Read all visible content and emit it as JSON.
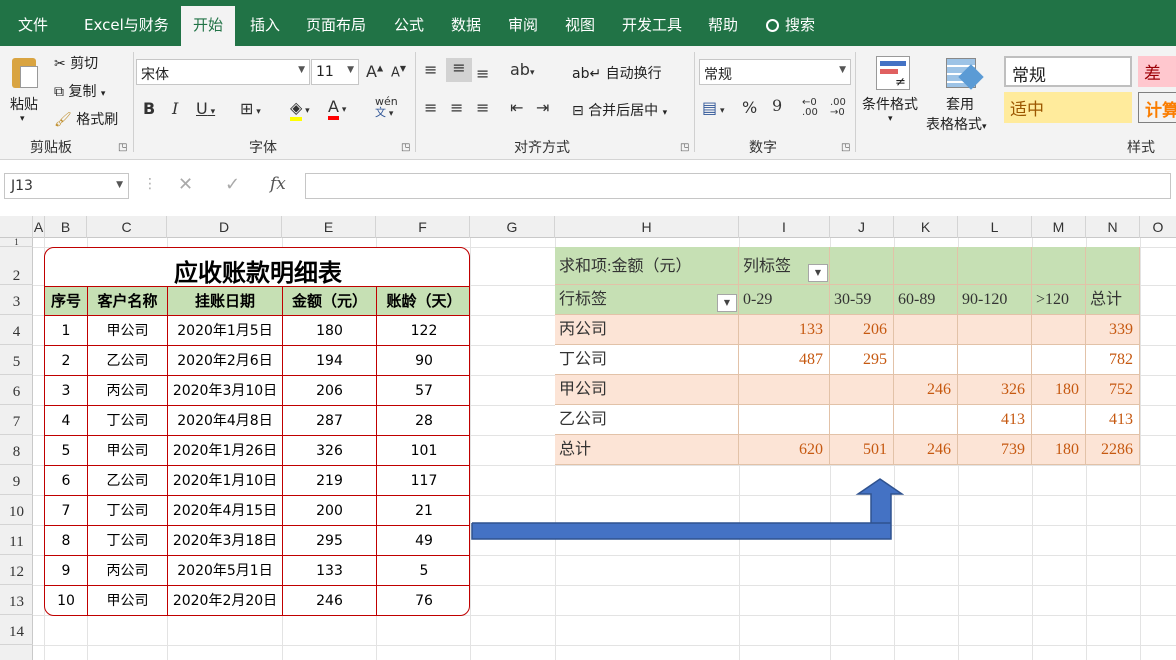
{
  "menu": {
    "items": [
      "文件",
      "Excel与财务",
      "开始",
      "插入",
      "页面布局",
      "公式",
      "数据",
      "审阅",
      "视图",
      "开发工具",
      "帮助"
    ],
    "search": "搜索",
    "active": "开始"
  },
  "ribbon": {
    "clipboard": {
      "paste": "粘贴",
      "cut": "剪切",
      "copy": "复制",
      "format_painter": "格式刷",
      "label": "剪贴板"
    },
    "font": {
      "name": "宋体",
      "size": "11",
      "label": "字体",
      "grow": "A",
      "shrink": "A",
      "bold": "B",
      "italic": "I",
      "underline": "U",
      "wen": "wén",
      "wenzi": "文"
    },
    "alignment": {
      "wrap": "自动换行",
      "merge": "合并后居中",
      "label": "对齐方式"
    },
    "number": {
      "format": "常规",
      "percent": "%",
      "comma": "9",
      "label": "数字"
    },
    "styles": {
      "conditional": "条件格式",
      "table_format_1": "套用",
      "table_format_2": "表格格式",
      "normal": "常规",
      "bad": "差",
      "neutral": "适中",
      "calc": "计算",
      "label": "样式"
    }
  },
  "formula_bar": {
    "name_box": "J13",
    "fx": "fx",
    "value": ""
  },
  "columns": [
    "A",
    "B",
    "C",
    "D",
    "E",
    "F",
    "G",
    "H",
    "I",
    "J",
    "K",
    "L",
    "M",
    "N",
    "O"
  ],
  "rows": [
    "1",
    "2",
    "3",
    "4",
    "5",
    "6",
    "7",
    "8",
    "9",
    "10",
    "11",
    "12",
    "13",
    "14"
  ],
  "ledger": {
    "title": "应收账款明细表",
    "headers": [
      "序号",
      "客户名称",
      "挂账日期",
      "金额（元）",
      "账龄（天）"
    ],
    "rows": [
      [
        "1",
        "甲公司",
        "2020年1月5日",
        "180",
        "122"
      ],
      [
        "2",
        "乙公司",
        "2020年2月6日",
        "194",
        "90"
      ],
      [
        "3",
        "丙公司",
        "2020年3月10日",
        "206",
        "57"
      ],
      [
        "4",
        "丁公司",
        "2020年4月8日",
        "287",
        "28"
      ],
      [
        "5",
        "甲公司",
        "2020年1月26日",
        "326",
        "101"
      ],
      [
        "6",
        "乙公司",
        "2020年1月10日",
        "219",
        "117"
      ],
      [
        "7",
        "丁公司",
        "2020年4月15日",
        "200",
        "21"
      ],
      [
        "8",
        "丁公司",
        "2020年3月18日",
        "295",
        "49"
      ],
      [
        "9",
        "丙公司",
        "2020年5月1日",
        "133",
        "5"
      ],
      [
        "10",
        "甲公司",
        "2020年2月20日",
        "246",
        "76"
      ]
    ]
  },
  "pivot": {
    "value_label": "求和项:金额（元）",
    "col_label": "列标签",
    "row_label": "行标签",
    "col_headers": [
      "0-29",
      "30-59",
      "60-89",
      "90-120",
      ">120",
      "总计"
    ],
    "rows": [
      [
        "丙公司",
        "133",
        "206",
        "",
        "",
        "",
        "339"
      ],
      [
        "丁公司",
        "487",
        "295",
        "",
        "",
        "",
        "782"
      ],
      [
        "甲公司",
        "",
        "",
        "246",
        "326",
        "180",
        "752"
      ],
      [
        "乙公司",
        "",
        "",
        "",
        "413",
        "",
        "413"
      ],
      [
        "总计",
        "620",
        "501",
        "246",
        "739",
        "180",
        "2286"
      ]
    ]
  },
  "colors": {
    "accent": "#217346",
    "arrow": "#4472c4",
    "pivot_header": "#c6e0b4",
    "pivot_band": "#fce4d6",
    "value_text": "#c65911",
    "table_border": "#c00000"
  }
}
